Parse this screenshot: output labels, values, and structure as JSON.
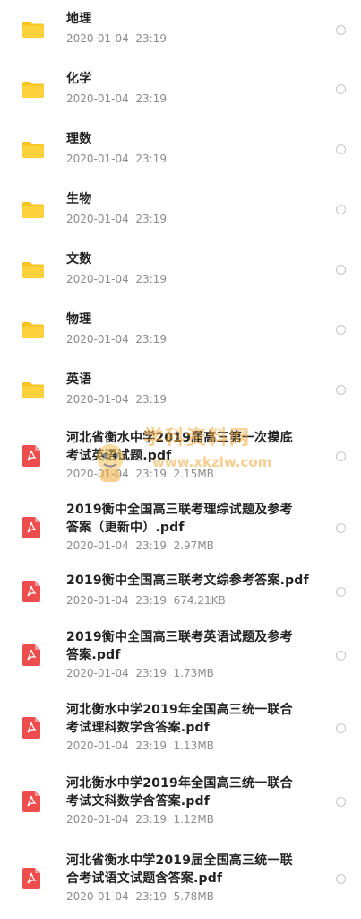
{
  "items": [
    {
      "type": "folder",
      "name": "地理",
      "date": "2020-01-04  23:19",
      "size": ""
    },
    {
      "type": "folder",
      "name": "化学",
      "date": "2020-01-04  23:19",
      "size": ""
    },
    {
      "type": "folder",
      "name": "理数",
      "date": "2020-01-04  23:19",
      "size": ""
    },
    {
      "type": "folder",
      "name": "生物",
      "date": "2020-01-04  23:19",
      "size": ""
    },
    {
      "type": "folder",
      "name": "文数",
      "date": "2020-01-04  23:19",
      "size": ""
    },
    {
      "type": "folder",
      "name": "物理",
      "date": "2020-01-04  23:19",
      "size": ""
    },
    {
      "type": "folder",
      "name": "英语",
      "date": "2020-01-04  23:19",
      "size": ""
    },
    {
      "type": "pdf",
      "name": "河北省衡水中学2019届高三第一次摸底\n考试英语试题.pdf",
      "date": "2020-01-04  23:19",
      "size": "2.15MB"
    },
    {
      "type": "pdf",
      "name": "2019衡中全国高三联考理综试题及参考\n答案（更新中）.pdf",
      "date": "2020-01-04  23:19",
      "size": "2.97MB"
    },
    {
      "type": "pdf",
      "name": "2019衡中全国高三联考文综参考答案.pdf",
      "date": "2020-01-04  23:19",
      "size": "674.21KB"
    },
    {
      "type": "pdf",
      "name": "2019衡中全国高三联考英语试题及参考\n答案.pdf",
      "date": "2020-01-04  23:19",
      "size": "1.73MB"
    },
    {
      "type": "pdf",
      "name": "河北衡水中学2019年全国高三统一联合\n考试理科数学含答案.pdf",
      "date": "2020-01-04  23:19",
      "size": "1.13MB"
    },
    {
      "type": "pdf",
      "name": "河北衡水中学2019年全国高三统一联合\n考试文科数学含答案.pdf",
      "date": "2020-01-04  23:19",
      "size": "1.12MB"
    },
    {
      "type": "pdf",
      "name": "河北省衡水中学2019届全国高三统一联\n合考试语文试题含答案.pdf",
      "date": "2020-01-04  23:19",
      "size": "5.78MB"
    }
  ],
  "watermark": {
    "text1": "学科资料网",
    "text2": "www.xkzlw.com"
  },
  "colors": {
    "folder": "#f7c31e",
    "pdf": "#ee4d4d",
    "name": "#222222",
    "meta": "#8c8c8c",
    "radio": "#c4c4c4"
  }
}
